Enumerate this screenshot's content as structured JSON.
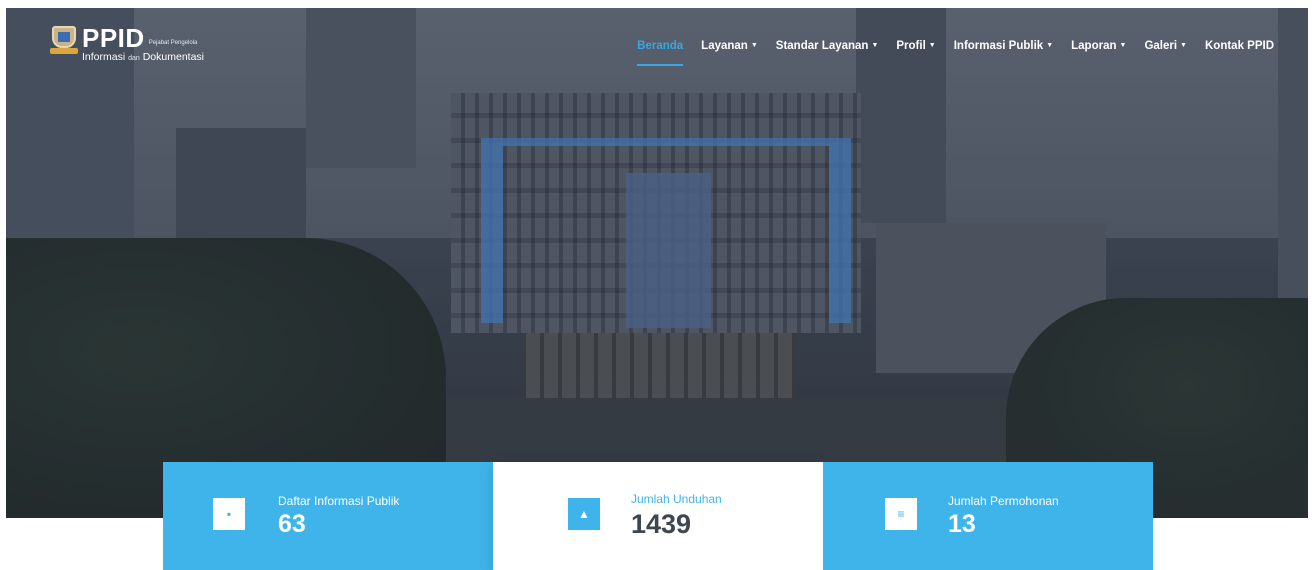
{
  "brand": {
    "name": "PPID",
    "small": "Pejabat Pengelola",
    "sub_left": "Informasi",
    "sub_mid": "dan",
    "sub_right": "Dokumentasi",
    "logo_icon": "city-crest-icon"
  },
  "nav": {
    "items": [
      {
        "label": "Beranda",
        "dropdown": false,
        "active": true
      },
      {
        "label": "Layanan",
        "dropdown": true,
        "active": false
      },
      {
        "label": "Standar Layanan",
        "dropdown": true,
        "active": false
      },
      {
        "label": "Profil",
        "dropdown": true,
        "active": false
      },
      {
        "label": "Informasi Publik",
        "dropdown": true,
        "active": false
      },
      {
        "label": "Laporan",
        "dropdown": true,
        "active": false
      },
      {
        "label": "Galeri",
        "dropdown": true,
        "active": false
      },
      {
        "label": "Kontak PPID",
        "dropdown": false,
        "active": false
      }
    ],
    "caret": "▼"
  },
  "stats": [
    {
      "label": "Daftar Informasi Publik",
      "value": "63",
      "icon": "document-icon",
      "icon_glyph": "▪"
    },
    {
      "label": "Jumlah Unduhan",
      "value": "1439",
      "icon": "download-icon",
      "icon_glyph": "▲"
    },
    {
      "label": "Jumlah Permohonan",
      "value": "13",
      "icon": "list-icon",
      "icon_glyph": "≡"
    }
  ],
  "colors": {
    "accent": "#3fb4ea",
    "nav_active": "#3aa6e4",
    "stat_value_dark": "#3e4652"
  }
}
